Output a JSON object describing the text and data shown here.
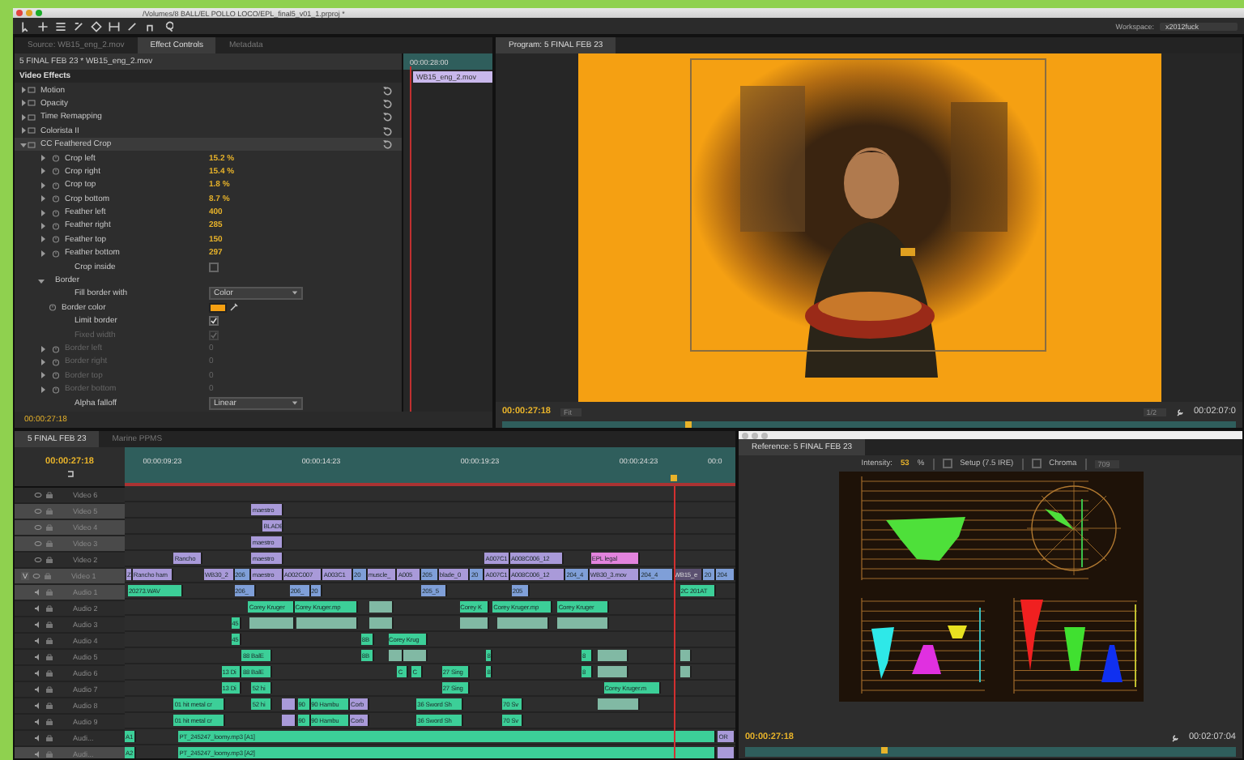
{
  "window": {
    "title": "/Volumes/8 BALL/EL POLLO LOCO/EPL_final5_v01_1.prproj *"
  },
  "toolbar": {
    "workspace_label": "Workspace:",
    "workspace": "x2012fuck"
  },
  "effect_controls": {
    "tabs": [
      {
        "label": "Source: WB15_eng_2.mov",
        "selected": false
      },
      {
        "label": "Effect Controls",
        "selected": true
      },
      {
        "label": "Metadata",
        "selected": false
      }
    ],
    "clip_path": "5 FINAL FEB 23 * WB15_eng_2.mov",
    "section": "Video Effects",
    "mini_time": "00:00:28:00",
    "mini_clip": "WB15_eng_2.mov",
    "rows": [
      {
        "kind": "group",
        "label": "Motion",
        "expanded": false
      },
      {
        "kind": "group",
        "label": "Opacity",
        "expanded": false
      },
      {
        "kind": "group",
        "label": "Time Remapping",
        "expanded": false
      },
      {
        "kind": "group",
        "label": "Colorista II",
        "expanded": false
      },
      {
        "kind": "group",
        "label": "CC Feathered Crop",
        "expanded": true
      },
      {
        "kind": "param",
        "label": "Crop left",
        "value": "15.2 %",
        "disabled": false
      },
      {
        "kind": "param",
        "label": "Crop right",
        "value": "15.4 %",
        "disabled": false
      },
      {
        "kind": "param",
        "label": "Crop top",
        "value": "1.8 %",
        "disabled": false
      },
      {
        "kind": "param",
        "label": "Crop bottom",
        "value": "8.7 %",
        "disabled": false
      },
      {
        "kind": "param",
        "label": "Feather left",
        "value": "400",
        "disabled": false
      },
      {
        "kind": "param",
        "label": "Feather right",
        "value": "285",
        "disabled": false
      },
      {
        "kind": "param",
        "label": "Feather top",
        "value": "150",
        "disabled": false
      },
      {
        "kind": "param",
        "label": "Feather bottom",
        "value": "297",
        "disabled": false
      },
      {
        "kind": "checkbox",
        "label": "Crop inside",
        "checked": false,
        "disabled": false
      },
      {
        "kind": "section",
        "label": "Border",
        "expanded": true
      },
      {
        "kind": "dropdown",
        "label": "Fill border with",
        "value": "Color"
      },
      {
        "kind": "color",
        "label": "Border color",
        "color": "#f5a012"
      },
      {
        "kind": "checkbox",
        "label": "Limit border",
        "checked": true,
        "disabled": false
      },
      {
        "kind": "checkbox",
        "label": "Fixed width",
        "checked": true,
        "disabled": true
      },
      {
        "kind": "param",
        "label": "Border left",
        "value": "0",
        "disabled": true
      },
      {
        "kind": "param",
        "label": "Border right",
        "value": "0",
        "disabled": true
      },
      {
        "kind": "param",
        "label": "Border top",
        "value": "0",
        "disabled": true
      },
      {
        "kind": "param",
        "label": "Border bottom",
        "value": "0",
        "disabled": true
      },
      {
        "kind": "dropdown",
        "label": "Alpha falloff",
        "value": "Linear"
      }
    ],
    "timecode": "00:00:27:18"
  },
  "program": {
    "tab": "Program: 5 FINAL FEB 23",
    "timecode": "00:00:27:18",
    "zoom": "Fit",
    "resolution": "1/2",
    "duration": "00:02:07:0"
  },
  "timeline": {
    "tabs": [
      {
        "label": "5 FINAL FEB 23",
        "selected": true
      },
      {
        "label": "Marine PPMS",
        "selected": false
      }
    ],
    "timecode": "00:00:27:18",
    "ruler": [
      "00:00:09:23",
      "00:00:14:23",
      "00:00:19:23",
      "00:00:24:23",
      "00:0"
    ],
    "tracks": [
      {
        "name": "Video 6",
        "kind": "video",
        "selected": false
      },
      {
        "name": "Video 5",
        "kind": "video",
        "selected": true,
        "clips": [
          {
            "kind": "video",
            "label": "maestro"
          }
        ]
      },
      {
        "name": "Video 4",
        "kind": "video",
        "selected": true,
        "clips": [
          {
            "kind": "video",
            "label": "BLADE"
          }
        ]
      },
      {
        "name": "Video 3",
        "kind": "video",
        "selected": true,
        "clips": [
          {
            "kind": "video",
            "label": "maestro"
          }
        ]
      },
      {
        "name": "Video 2",
        "kind": "video",
        "selected": false,
        "clips": [
          {
            "kind": "video",
            "label": "Rancho"
          },
          {
            "kind": "video",
            "label": "maestro"
          },
          {
            "kind": "video",
            "label": "A007C1"
          },
          {
            "kind": "video",
            "label": "A008C006_12"
          },
          {
            "kind": "title",
            "label": "EPL legal"
          }
        ]
      },
      {
        "name": "Video 1",
        "kind": "video",
        "selected": true,
        "source_patch": "V",
        "clips": [
          {
            "kind": "video",
            "label": "Z"
          },
          {
            "kind": "video",
            "label": "Rancho ham"
          },
          {
            "kind": "video",
            "label": "WB30_2"
          },
          {
            "kind": "nested",
            "label": "206"
          },
          {
            "kind": "video",
            "label": "maestro"
          },
          {
            "kind": "video",
            "label": "A002C007"
          },
          {
            "kind": "video",
            "label": "A003C1"
          },
          {
            "kind": "nested",
            "label": "20"
          },
          {
            "kind": "video",
            "label": "muscle_"
          },
          {
            "kind": "video",
            "label": "A005"
          },
          {
            "kind": "nested",
            "label": "205"
          },
          {
            "kind": "video",
            "label": "blade_0"
          },
          {
            "kind": "nested",
            "label": "20"
          },
          {
            "kind": "video",
            "label": "A007C1"
          },
          {
            "kind": "video",
            "label": "A008C006_12"
          },
          {
            "kind": "nested",
            "label": "204_4"
          },
          {
            "kind": "video",
            "label": "WB30_3.mov"
          },
          {
            "kind": "nested",
            "label": "204_4"
          },
          {
            "kind": "selected",
            "label": "WB15_e"
          },
          {
            "kind": "nested",
            "label": "20"
          },
          {
            "kind": "nested",
            "label": "204"
          }
        ]
      },
      {
        "name": "Audio 1",
        "kind": "audio",
        "selected": true,
        "clips": [
          {
            "kind": "audio",
            "label": "20273.WAV"
          },
          {
            "kind": "nested",
            "label": "206_"
          },
          {
            "kind": "nested",
            "label": "206_"
          },
          {
            "kind": "nested",
            "label": "20"
          },
          {
            "kind": "nested",
            "label": "205_5"
          },
          {
            "kind": "nested",
            "label": "205"
          },
          {
            "kind": "audio",
            "label": "2C 201AT"
          }
        ]
      },
      {
        "name": "Audio 2",
        "kind": "audio",
        "selected": false,
        "clips": [
          {
            "kind": "audio",
            "label": "Corey Kruger"
          },
          {
            "kind": "audio",
            "label": "Corey Kruger.mp"
          },
          {
            "kind": "faded"
          },
          {
            "kind": "audio",
            "label": "Corey K"
          },
          {
            "kind": "audio",
            "label": "Corey Kruger.mp"
          },
          {
            "kind": "audio",
            "label": "Corey Kruger"
          }
        ]
      },
      {
        "name": "Audio 3",
        "kind": "audio",
        "selected": false,
        "clips": [
          {
            "kind": "audio",
            "label": "45"
          },
          {
            "kind": "faded"
          },
          {
            "kind": "faded"
          },
          {
            "kind": "faded"
          },
          {
            "kind": "faded"
          },
          {
            "kind": "faded"
          },
          {
            "kind": "faded"
          }
        ]
      },
      {
        "name": "Audio 4",
        "kind": "audio",
        "selected": false,
        "clips": [
          {
            "kind": "audio",
            "label": "45"
          },
          {
            "kind": "audio",
            "label": "8B"
          },
          {
            "kind": "audio",
            "label": "Corey Krug"
          }
        ]
      },
      {
        "name": "Audio 5",
        "kind": "audio",
        "selected": false,
        "clips": [
          {
            "kind": "audio",
            "label": "88 BalE"
          },
          {
            "kind": "audio",
            "label": "8B"
          },
          {
            "kind": "faded"
          },
          {
            "kind": "faded"
          },
          {
            "kind": "audio",
            "label": "8"
          },
          {
            "kind": "audio",
            "label": "8"
          },
          {
            "kind": "faded"
          },
          {
            "kind": "faded"
          }
        ]
      },
      {
        "name": "Audio 6",
        "kind": "audio",
        "selected": false,
        "clips": [
          {
            "kind": "audio",
            "label": "13 Di"
          },
          {
            "kind": "audio",
            "label": "88 BalE"
          },
          {
            "kind": "audio",
            "label": "C"
          },
          {
            "kind": "audio",
            "label": "C"
          },
          {
            "kind": "audio",
            "label": "27 Sing"
          },
          {
            "kind": "audio",
            "label": "8"
          },
          {
            "kind": "audio",
            "label": "8"
          },
          {
            "kind": "faded"
          },
          {
            "kind": "faded"
          }
        ]
      },
      {
        "name": "Audio 7",
        "kind": "audio",
        "selected": false,
        "clips": [
          {
            "kind": "audio",
            "label": "13 Di"
          },
          {
            "kind": "audio",
            "label": "52 hi"
          },
          {
            "kind": "audio",
            "label": "27 Sing"
          },
          {
            "kind": "audio",
            "label": "Corey Kruger.m"
          }
        ]
      },
      {
        "name": "Audio 8",
        "kind": "audio",
        "selected": false,
        "clips": [
          {
            "kind": "audio",
            "label": "01 hit metal cr"
          },
          {
            "kind": "audio",
            "label": "52 hi"
          },
          {
            "kind": "video"
          },
          {
            "kind": "audio",
            "label": "90"
          },
          {
            "kind": "audio",
            "label": "90 Hambu"
          },
          {
            "kind": "video",
            "label": "Corb"
          },
          {
            "kind": "audio",
            "label": "36 Sword Sh"
          },
          {
            "kind": "audio",
            "label": "70 Sv"
          },
          {
            "kind": "faded"
          }
        ]
      },
      {
        "name": "Audio 9",
        "kind": "audio",
        "selected": false,
        "clips": [
          {
            "kind": "audio",
            "label": "01 hit metal cr"
          },
          {
            "kind": "video"
          },
          {
            "kind": "audio",
            "label": "90"
          },
          {
            "kind": "audio",
            "label": "90 Hambu"
          },
          {
            "kind": "video",
            "label": "Corb"
          },
          {
            "kind": "audio",
            "label": "36 Sword Sh"
          },
          {
            "kind": "audio",
            "label": "70 Sv"
          }
        ]
      },
      {
        "name": "Audi...",
        "kind": "audio",
        "selected": false,
        "clips": [
          {
            "kind": "audio",
            "label": "A1"
          },
          {
            "kind": "audio",
            "label": "PT_245247_loomy.mp3 [A1]"
          },
          {
            "kind": "video",
            "label": "OR"
          }
        ]
      },
      {
        "name": "Audi...",
        "kind": "audio",
        "selected": true,
        "clips": [
          {
            "kind": "audio",
            "label": "A2"
          },
          {
            "kind": "audio",
            "label": "PT_245247_loomy.mp3 [A2]"
          },
          {
            "kind": "video"
          }
        ]
      }
    ]
  },
  "scopes": {
    "tab": "Reference: 5 FINAL FEB 23",
    "intensity_label": "Intensity:",
    "intensity": "53",
    "intensity_unit": "%",
    "setup": {
      "label": "Setup (7.5 IRE)",
      "checked": false
    },
    "chroma": {
      "label": "Chroma",
      "checked": false
    },
    "standard": "709",
    "timecode": "00:00:27:18",
    "duration": "00:02:07:04"
  }
}
